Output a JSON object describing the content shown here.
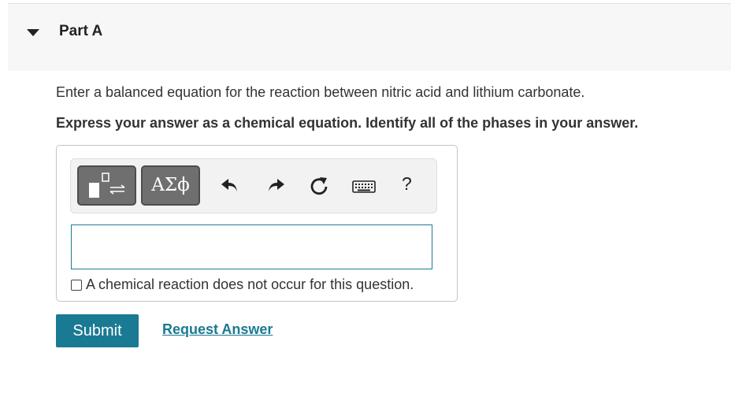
{
  "part": {
    "title": "Part A"
  },
  "question": {
    "prompt": "Enter a balanced equation for the reaction between nitric acid and lithium carbonate.",
    "instruction": "Express your answer as a chemical equation. Identify all of the phases in your answer."
  },
  "toolbar": {
    "symbols_label": "ΑΣϕ",
    "help_label": "?",
    "icons": [
      "templates-icon",
      "undo-icon",
      "redo-icon",
      "reset-icon",
      "keyboard-icon"
    ]
  },
  "answer": {
    "value": ""
  },
  "no_reaction_label": "A chemical reaction does not occur for this question.",
  "actions": {
    "submit_label": "Submit",
    "request_answer_label": "Request Answer"
  },
  "colors": {
    "accent": "#1a7a93",
    "header_bg": "#f7f7f7",
    "button_dark": "#6f6f6f"
  }
}
